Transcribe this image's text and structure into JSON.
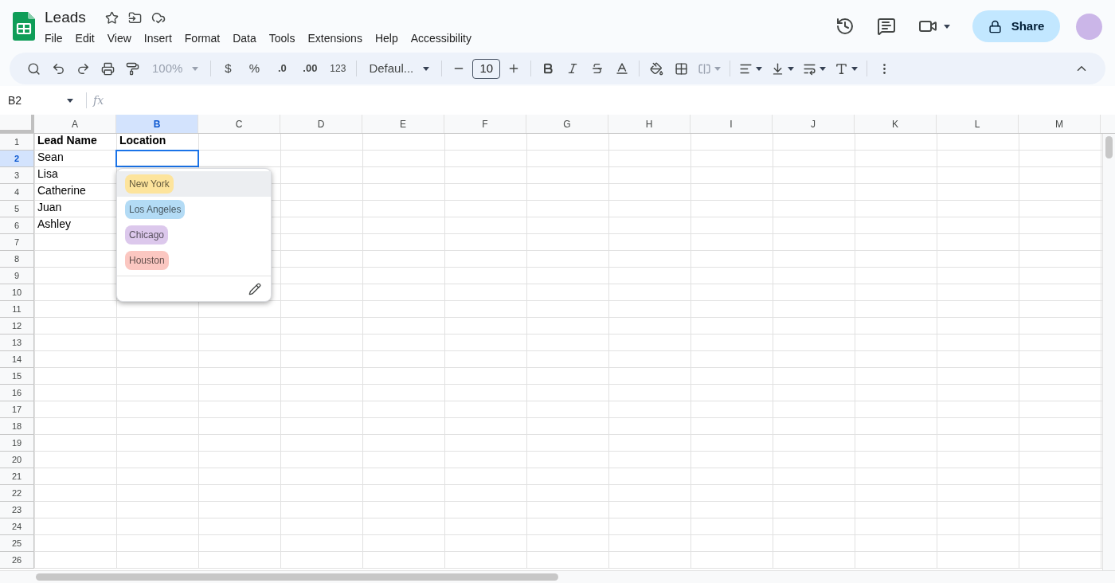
{
  "document": {
    "title": "Leads",
    "menu": [
      "File",
      "Edit",
      "View",
      "Insert",
      "Format",
      "Data",
      "Tools",
      "Extensions",
      "Help",
      "Accessibility"
    ]
  },
  "share_button": {
    "label": "Share"
  },
  "toolbar": {
    "zoom": "100%",
    "currency": "$",
    "percent": "%",
    "decrease_decimals": ".0",
    "increase_decimals": ".00",
    "number_format": "123",
    "font": "Defaul...",
    "font_size": "10"
  },
  "formula_bar": {
    "name_box": "B2",
    "fx": "fx"
  },
  "columns": [
    {
      "label": "A",
      "selected": false
    },
    {
      "label": "B",
      "selected": true
    },
    {
      "label": "C",
      "selected": false
    },
    {
      "label": "D",
      "selected": false
    },
    {
      "label": "E",
      "selected": false
    },
    {
      "label": "F",
      "selected": false
    },
    {
      "label": "G",
      "selected": false
    },
    {
      "label": "H",
      "selected": false
    },
    {
      "label": "I",
      "selected": false
    },
    {
      "label": "J",
      "selected": false
    },
    {
      "label": "K",
      "selected": false
    },
    {
      "label": "L",
      "selected": false
    },
    {
      "label": "M",
      "selected": false
    }
  ],
  "rows": [
    {
      "number": "1",
      "selected": false,
      "cells": [
        "Lead Name",
        "Location"
      ]
    },
    {
      "number": "2",
      "selected": true,
      "cells": [
        "Sean"
      ]
    },
    {
      "number": "3",
      "selected": false,
      "cells": [
        "Lisa"
      ]
    },
    {
      "number": "4",
      "selected": false,
      "cells": [
        "Catherine"
      ]
    },
    {
      "number": "5",
      "selected": false,
      "cells": [
        "Juan"
      ]
    },
    {
      "number": "6",
      "selected": false,
      "cells": [
        "Ashley"
      ]
    },
    {
      "number": "7",
      "selected": false,
      "cells": []
    },
    {
      "number": "8",
      "selected": false,
      "cells": []
    },
    {
      "number": "9",
      "selected": false,
      "cells": []
    },
    {
      "number": "10",
      "selected": false,
      "cells": []
    },
    {
      "number": "11",
      "selected": false,
      "cells": []
    },
    {
      "number": "12",
      "selected": false,
      "cells": []
    },
    {
      "number": "13",
      "selected": false,
      "cells": []
    },
    {
      "number": "14",
      "selected": false,
      "cells": []
    },
    {
      "number": "15",
      "selected": false,
      "cells": []
    },
    {
      "number": "16",
      "selected": false,
      "cells": []
    },
    {
      "number": "17",
      "selected": false,
      "cells": []
    },
    {
      "number": "18",
      "selected": false,
      "cells": []
    },
    {
      "number": "19",
      "selected": false,
      "cells": []
    },
    {
      "number": "20",
      "selected": false,
      "cells": []
    },
    {
      "number": "21",
      "selected": false,
      "cells": []
    },
    {
      "number": "22",
      "selected": false,
      "cells": []
    },
    {
      "number": "23",
      "selected": false,
      "cells": []
    },
    {
      "number": "24",
      "selected": false,
      "cells": []
    },
    {
      "number": "25",
      "selected": false,
      "cells": []
    },
    {
      "number": "26",
      "selected": false,
      "cells": []
    }
  ],
  "dropdown": {
    "options": [
      {
        "label": "New York",
        "color": "#fde49c",
        "selected": true
      },
      {
        "label": "Los Angeles",
        "color": "#b3dbf5",
        "selected": false
      },
      {
        "label": "Chicago",
        "color": "#dcc8ec",
        "selected": false
      },
      {
        "label": "Houston",
        "color": "#fbc7c1",
        "selected": false
      }
    ]
  }
}
